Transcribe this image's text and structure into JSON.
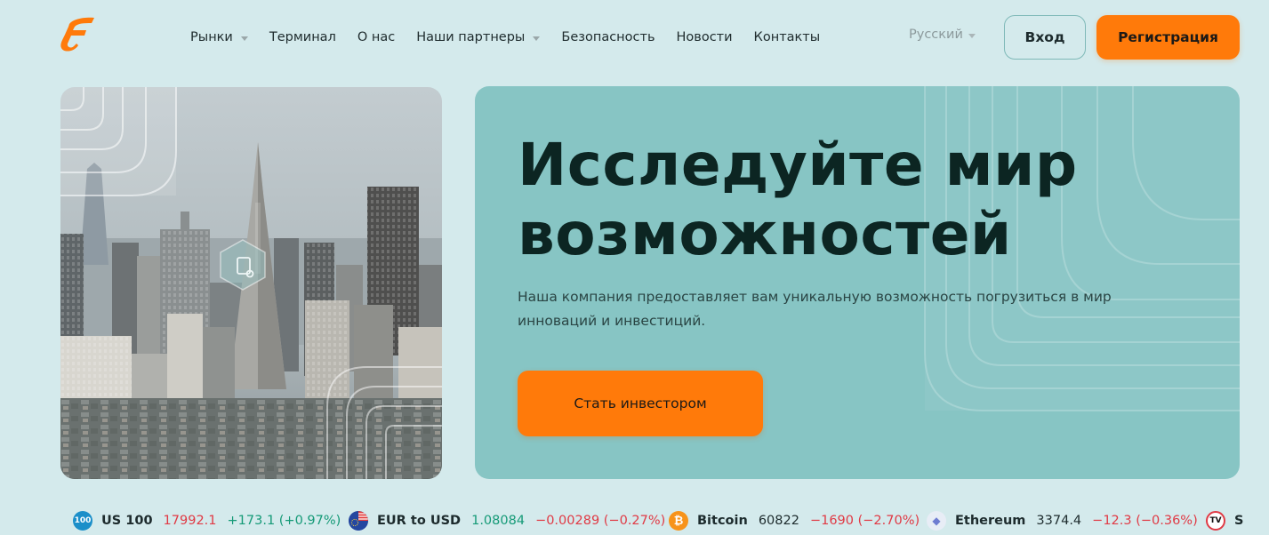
{
  "brand": {
    "logo_icon": "f-brand-logo-icon",
    "accent": "#ff7a0a"
  },
  "nav": {
    "items": [
      {
        "label": "Рынки",
        "has_dropdown": true
      },
      {
        "label": "Терминал",
        "has_dropdown": false
      },
      {
        "label": "О нас",
        "has_dropdown": false
      },
      {
        "label": "Наши партнеры",
        "has_dropdown": true
      },
      {
        "label": "Безопасность",
        "has_dropdown": false
      },
      {
        "label": "Новости",
        "has_dropdown": false
      },
      {
        "label": "Контакты",
        "has_dropdown": false
      }
    ],
    "language": "Русский",
    "login_label": "Вход",
    "register_label": "Регистрация"
  },
  "hero": {
    "title": "Исследуйте мир возможностей",
    "subtitle": "Наша компания предоставляет вам уникальную возможность погрузиться в мир инноваций и инвестиций.",
    "cta_label": "Стать инвестором",
    "image_icon": "city-skyline-image"
  },
  "ticker": [
    {
      "icon": "nasdaq-100-icon",
      "icon_text": "100",
      "name": "US 100",
      "price": "17992.1",
      "price_color": "down",
      "change": "+173.1 (+0.97%)",
      "change_color": "up"
    },
    {
      "icon": "eu-us-flag-icon",
      "icon_text": "",
      "name": "EUR to USD",
      "price": "1.08084",
      "price_color": "up",
      "change": "−0.00289 (−0.27%)",
      "change_color": "down"
    },
    {
      "icon": "bitcoin-icon",
      "icon_text": "₿",
      "name": "Bitcoin",
      "price": "60822",
      "price_color": "neutral",
      "change": "−1690 (−2.70%)",
      "change_color": "down"
    },
    {
      "icon": "ethereum-icon",
      "icon_text": "◆",
      "name": "Ethereum",
      "price": "3374.4",
      "price_color": "neutral",
      "change": "−12.3 (−0.36%)",
      "change_color": "down"
    },
    {
      "icon": "tradingview-icon",
      "icon_text": "TV",
      "name": "S",
      "price": "",
      "price_color": "neutral",
      "change": "",
      "change_color": "neutral"
    }
  ]
}
